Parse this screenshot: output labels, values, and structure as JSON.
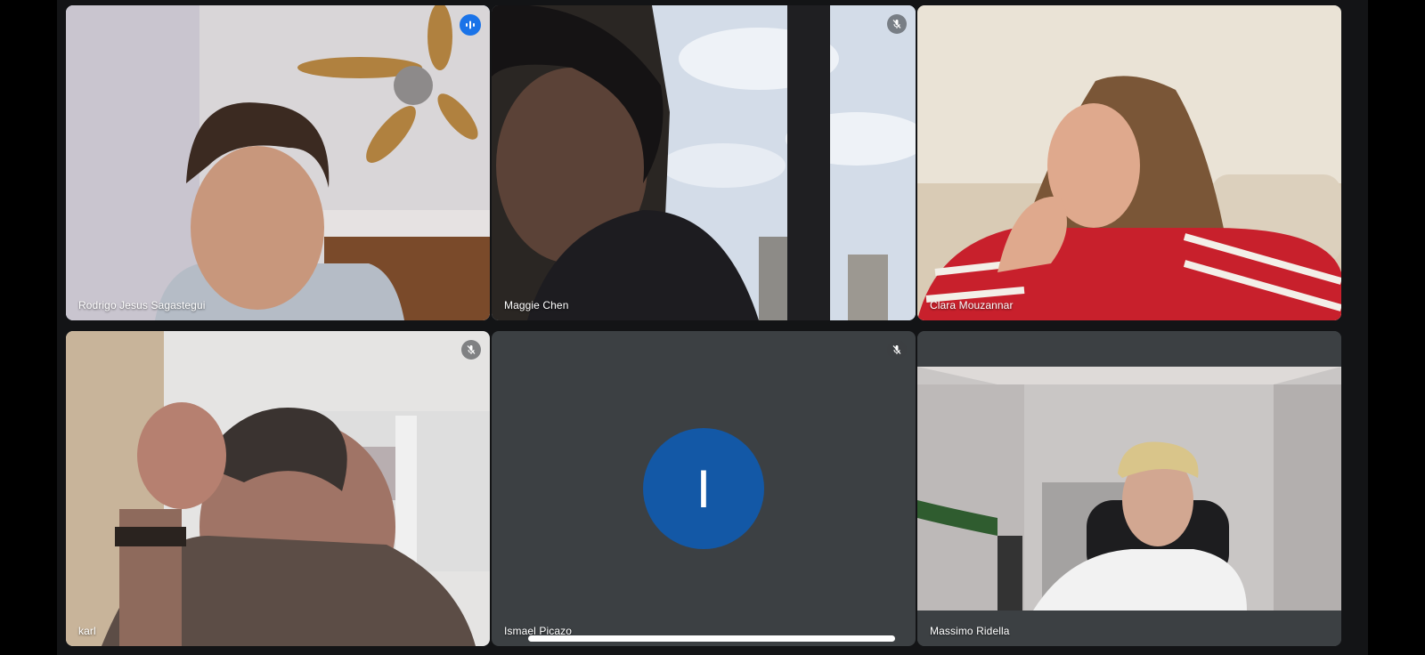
{
  "colors": {
    "tile_bg": "#3c4043",
    "active_outline": "#8ab4f8",
    "speaking_badge": "#1a73e8",
    "avatar_bg": "#1358a6"
  },
  "participants": [
    {
      "name": "Rodrigo Jesus Sagastegui",
      "status": "speaking",
      "status_icon": "speaking-icon"
    },
    {
      "name": "Maggie Chen",
      "status": "muted",
      "status_icon": "mic-off-icon"
    },
    {
      "name": "Clara Mouzannar",
      "status": "none",
      "status_icon": ""
    },
    {
      "name": "karl",
      "status": "muted",
      "status_icon": "mic-off-icon"
    },
    {
      "name": "Ismael Picazo",
      "status": "muted",
      "status_icon": "mic-off-icon",
      "avatar_letter": "I"
    },
    {
      "name": "Massimo Ridella",
      "status": "none",
      "status_icon": ""
    }
  ]
}
